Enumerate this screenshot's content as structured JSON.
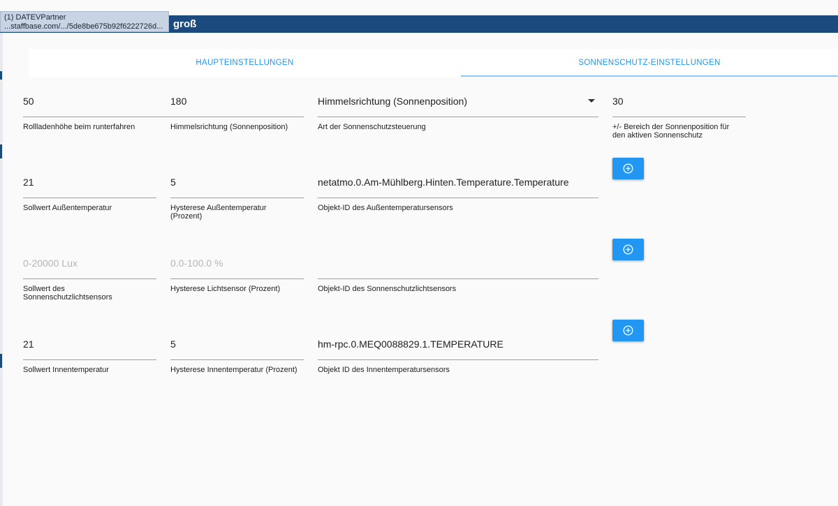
{
  "header": {
    "title": "groß",
    "tooltip_line1": "(1) DATEVPartner",
    "tooltip_line2": "...staffbase.com/.../5de8be675b92f6222726d..."
  },
  "tabs": {
    "main_label": "HAUPTEINSTELLUNGEN",
    "sun_label": "SONNENSCHUTZ-EINSTELLUNGEN"
  },
  "rows": {
    "r1": {
      "height_value": "50",
      "height_label": "Rollladenhöhe beim runterfahren",
      "direction_value": "180",
      "direction_label": "Himmelsrichtung (Sonnenposition)",
      "control_type_value": "Himmelsrichtung (Sonnenposition)",
      "control_type_label": "Art der Sonnenschutzsteuerung",
      "range_value": "30",
      "range_label_line1": "+/- Bereich der Sonnenposition für",
      "range_label_line2": "den aktiven Sonnenschutz"
    },
    "r2": {
      "setpoint_value": "21",
      "setpoint_label": "Sollwert Außentemperatur",
      "hyst_value": "5",
      "hyst_label_line1": "Hysterese Außentemperatur",
      "hyst_label_line2": "(Prozent)",
      "object_value": "netatmo.0.Am-Mühlberg.Hinten.Temperature.Temperature",
      "object_label": "Objekt-ID des Außentemperatursensors"
    },
    "r3": {
      "setpoint_placeholder": "0-20000 Lux",
      "setpoint_label_line1": "Sollwert des",
      "setpoint_label_line2": "Sonnenschutzlichtsensors",
      "hyst_placeholder": "0.0-100.0 %",
      "hyst_label": "Hysterese Lichtsensor (Prozent)",
      "object_value": "",
      "object_label": "Objekt-ID des Sonnenschutzlichtsensors"
    },
    "r4": {
      "setpoint_value": "21",
      "setpoint_label": "Sollwert Innentemperatur",
      "hyst_value": "5",
      "hyst_label": "Hysterese Innentemperatur (Prozent)",
      "object_value": "hm-rpc.0.MEQ0088829.1.TEMPERATURE",
      "object_label": "Objekt ID des Innentemperatursensors"
    }
  },
  "icons": {
    "add": "plus-circle-icon",
    "dropdown": "caret-down-icon"
  },
  "colors": {
    "header": "#1b4a7e",
    "accent": "#2196f3",
    "tab_indicator": "#90caf9"
  }
}
